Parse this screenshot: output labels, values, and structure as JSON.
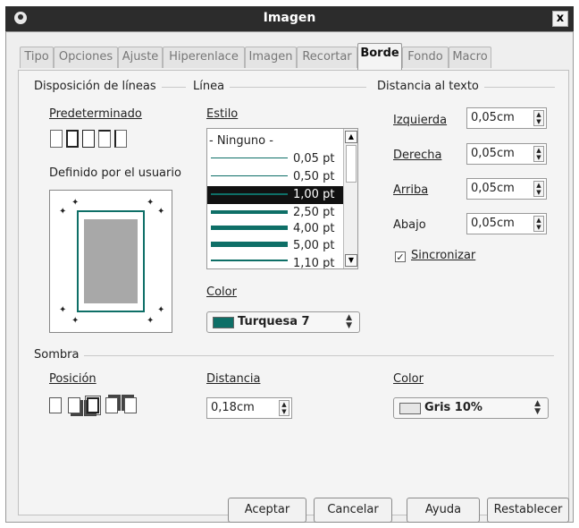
{
  "window": {
    "title": "Imagen",
    "close_glyph": "x"
  },
  "tabs": [
    "Tipo",
    "Opciones",
    "Ajuste",
    "Hiperenlace",
    "Imagen",
    "Recortar",
    "Borde",
    "Fondo",
    "Macro"
  ],
  "active_tab": "Borde",
  "line_arrangement": {
    "title": "Disposición de líneas",
    "default_label": "Predeterminado",
    "user_defined_label": "Definido por el usuario"
  },
  "line": {
    "title": "Línea",
    "style_label": "Estilo",
    "styles": [
      "- Ninguno -",
      "0,05 pt",
      "0,50 pt",
      "1,00 pt",
      "2,50 pt",
      "4,00 pt",
      "5,00 pt",
      "1,10 pt"
    ],
    "selected_style": "1,00 pt",
    "color_label": "Color",
    "color_value": "Turquesa 7",
    "color_hex": "#0e6f67"
  },
  "spacing": {
    "title": "Distancia al texto",
    "left_label": "Izquierda",
    "left_value": "0,05cm",
    "right_label": "Derecha",
    "right_value": "0,05cm",
    "top_label": "Arriba",
    "top_value": "0,05cm",
    "bottom_label": "Abajo",
    "bottom_value": "0,05cm",
    "sync_label": "Sincronizar",
    "sync_checked": true
  },
  "shadow": {
    "title": "Sombra",
    "position_label": "Posición",
    "distance_label": "Distancia",
    "distance_value": "0,18cm",
    "color_label": "Color",
    "color_value": "Gris 10%",
    "color_hex": "#e6e6e6"
  },
  "buttons": {
    "ok": "Aceptar",
    "cancel": "Cancelar",
    "help": "Ayuda",
    "reset": "Restablecer"
  },
  "icons": {
    "up": "up-arrow-icon",
    "down": "down-arrow-icon",
    "check": "check-icon"
  }
}
